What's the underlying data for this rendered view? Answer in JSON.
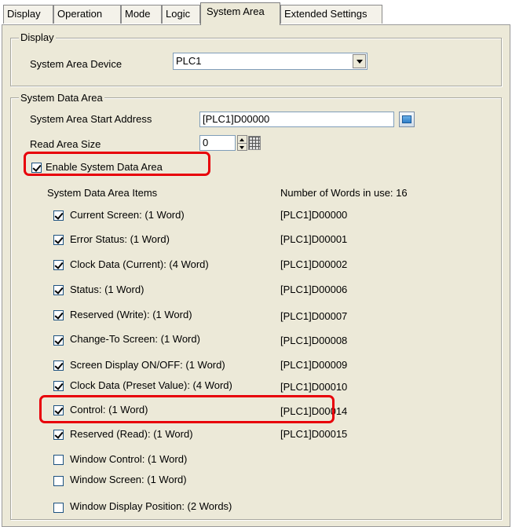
{
  "tabs": [
    {
      "label": "Display"
    },
    {
      "label": "Operation"
    },
    {
      "label": "Mode"
    },
    {
      "label": "Logic"
    },
    {
      "label": "System Area"
    },
    {
      "label": "Extended Settings"
    }
  ],
  "active_tab": "System Area",
  "display_group": {
    "legend": "Display",
    "device_label": "System Area Device",
    "device_value": "PLC1"
  },
  "system_data_group": {
    "legend": "System Data Area",
    "start_address_label": "System Area Start Address",
    "start_address_value": "[PLC1]D00000",
    "read_size_label": "Read Area Size",
    "read_size_value": "0",
    "enable_label": "Enable System Data Area",
    "enable_checked": true,
    "items_header": "System Data Area Items",
    "words_in_use": "Number of Words in use: 16",
    "items": [
      {
        "label": "Current Screen: (1 Word)",
        "checked": true,
        "address": "[PLC1]D00000"
      },
      {
        "label": "Error Status: (1 Word)",
        "checked": true,
        "address": "[PLC1]D00001"
      },
      {
        "label": "Clock Data (Current): (4 Word)",
        "checked": true,
        "address": "[PLC1]D00002"
      },
      {
        "label": "Status: (1 Word)",
        "checked": true,
        "address": "[PLC1]D00006"
      },
      {
        "label": "Reserved (Write): (1 Word)",
        "checked": true,
        "address": "[PLC1]D00007"
      },
      {
        "label": "Change-To Screen: (1 Word)",
        "checked": true,
        "address": "[PLC1]D00008"
      },
      {
        "label": "Screen Display ON/OFF: (1 Word)",
        "checked": true,
        "address": "[PLC1]D00009"
      },
      {
        "label": "Clock Data (Preset Value): (4 Word)",
        "checked": true,
        "address": "[PLC1]D00010"
      },
      {
        "label": "Control: (1 Word)",
        "checked": true,
        "address": "[PLC1]D00014"
      },
      {
        "label": "Reserved (Read): (1 Word)",
        "checked": true,
        "address": "[PLC1]D00015"
      },
      {
        "label": "Window Control: (1 Word)",
        "checked": false,
        "address": ""
      },
      {
        "label": "Window Screen: (1 Word)",
        "checked": false,
        "address": ""
      },
      {
        "label": "Window Display Position: (2 Words)",
        "checked": false,
        "address": ""
      }
    ]
  },
  "highlight_color": "#e8000a"
}
